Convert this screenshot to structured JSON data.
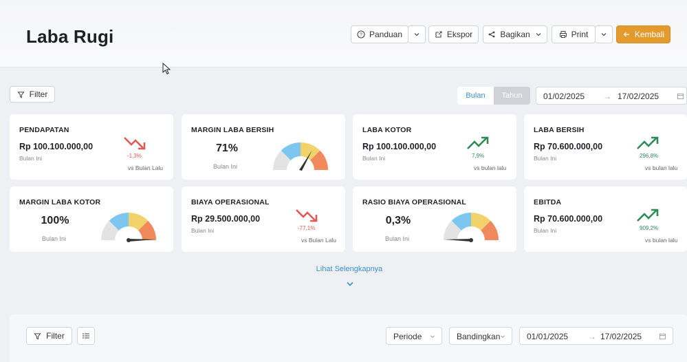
{
  "header": {
    "title": "Laba Rugi",
    "buttons": {
      "guide": "Panduan",
      "export": "Ekspor",
      "share": "Bagikan",
      "print": "Print",
      "back": "Kembali"
    }
  },
  "toolbar": {
    "filter_label": "Filter",
    "segment": [
      "Bulan",
      "Tahun"
    ],
    "segment_selected": "Bulan",
    "date_from": "01/02/2025",
    "date_to": "17/02/2025"
  },
  "cards": [
    {
      "title": "PENDAPATAN",
      "value": "Rp 100.100.000,00",
      "sub": "Bulan Ini",
      "pct": "-1,3%",
      "vs": "vs Bulan Lalu",
      "trend": "down"
    },
    {
      "title": "MARGIN LABA BERSIH",
      "value": "71%",
      "sub": "Bulan Ini",
      "gauge": 0.71
    },
    {
      "title": "LABA KOTOR",
      "value": "Rp 100.100.000,00",
      "sub": "Bulan Ini",
      "pct": "7,9%",
      "vs": "vs bulan lalu",
      "trend": "up"
    },
    {
      "title": "LABA BERSIH",
      "value": "Rp 70.600.000,00",
      "sub": "Bulan Ini",
      "pct": "296,8%",
      "vs": "vs bulan lalu",
      "trend": "up"
    },
    {
      "title": "MARGIN LABA KOTOR",
      "value": "100%",
      "sub": "Bulan Ini",
      "gauge": 1.0
    },
    {
      "title": "BIAYA OPERASIONAL",
      "value": "Rp 29.500.000,00",
      "sub": "Bulan Ini",
      "pct": "-77,1%",
      "vs": "vs Bulan Lalu",
      "trend": "down"
    },
    {
      "title": "RASIO BIAYA OPERASIONAL",
      "value": "0,3%",
      "sub": "Bulan Ini",
      "gauge": 0.003
    },
    {
      "title": "EBITDA",
      "value": "Rp 70.600.000,00",
      "sub": "Bulan Ini",
      "pct": "909,2%",
      "vs": "vs bulan lalu",
      "trend": "up"
    }
  ],
  "more_link": "Lihat Selengkapnya",
  "bottom": {
    "filter_label": "Filter",
    "period_label": "Periode",
    "compare_label": "Bandingkan",
    "date_from": "01/01/2025",
    "date_to": "17/02/2025"
  },
  "colors": {
    "accent": "#3b8fd0",
    "back_button": "#e59a2e",
    "up": "#2e8b57",
    "down": "#e05a55",
    "gauge": [
      "#e0e0e0",
      "#7cc6f0",
      "#f2d36b",
      "#f08a5d"
    ]
  }
}
